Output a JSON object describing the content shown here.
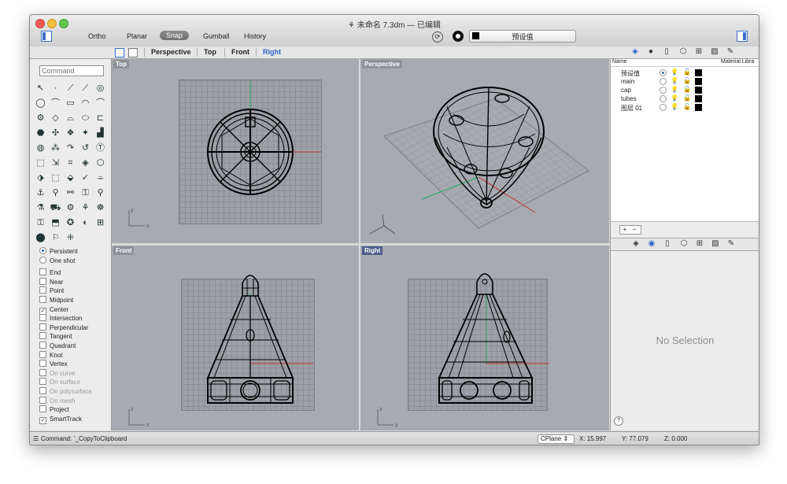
{
  "window": {
    "title": "未命名 7.3dm — 已编辑"
  },
  "toolbar": {
    "modes": [
      "Ortho",
      "Planar",
      "Snap",
      "Gumball",
      "History"
    ],
    "active_mode": "Snap",
    "current_layer": "预设值"
  },
  "viewbar": {
    "tabs": [
      "Perspective",
      "Top",
      "Front",
      "Right"
    ],
    "active_tab": "Right"
  },
  "left_panel": {
    "command_placeholder": "Command",
    "tools": [
      "↖",
      "·",
      "⟋",
      "⟋",
      "◎",
      "◯",
      "⌒",
      "▭",
      "◠",
      "⌒",
      "⚙",
      "◇",
      "⌓",
      "⬭",
      "⊏",
      "⬣",
      "✣",
      "❖",
      "✦",
      "▟",
      "◍",
      "⁂",
      "↷",
      "↺",
      "Ⓣ",
      "⬚",
      "⇲",
      "⌗",
      "◈",
      "⬡",
      "⬗",
      "⬚",
      "⬙",
      "✓",
      "⌯",
      "⚓",
      "⚲",
      "⚯",
      "⚿",
      "⚲",
      "⚗",
      "⛟",
      "⚙",
      "⚘",
      "☸",
      "⚿",
      "⬒",
      "✪",
      "◐",
      "⊞",
      "⬤",
      "⚐",
      "⁜"
    ],
    "snap_modes": [
      {
        "label": "Persistent",
        "type": "radio",
        "checked": true
      },
      {
        "label": "One shot",
        "type": "radio",
        "checked": false
      }
    ],
    "snaps": [
      {
        "label": "End",
        "checked": false,
        "disabled": false
      },
      {
        "label": "Near",
        "checked": false,
        "disabled": false
      },
      {
        "label": "Point",
        "checked": false,
        "disabled": false
      },
      {
        "label": "Midpoint",
        "checked": false,
        "disabled": false
      },
      {
        "label": "Center",
        "checked": true,
        "disabled": false
      },
      {
        "label": "Intersection",
        "checked": false,
        "disabled": false
      },
      {
        "label": "Perpendicular",
        "checked": false,
        "disabled": false
      },
      {
        "label": "Tangent",
        "checked": false,
        "disabled": false
      },
      {
        "label": "Quadrant",
        "checked": false,
        "disabled": false
      },
      {
        "label": "Knot",
        "checked": false,
        "disabled": false
      },
      {
        "label": "Vertex",
        "checked": false,
        "disabled": false
      },
      {
        "label": "On curve",
        "checked": false,
        "disabled": true
      },
      {
        "label": "On surface",
        "checked": false,
        "disabled": true
      },
      {
        "label": "On polysurface",
        "checked": false,
        "disabled": true
      },
      {
        "label": "On mesh",
        "checked": false,
        "disabled": true
      },
      {
        "label": "Project",
        "checked": false,
        "disabled": false
      },
      {
        "label": "SmartTrack",
        "checked": true,
        "disabled": false
      }
    ]
  },
  "viewports": {
    "top": {
      "label": "Top",
      "axis_a": "y",
      "axis_b": "x"
    },
    "perspective": {
      "label": "Perspective"
    },
    "front": {
      "label": "Front",
      "axis_a": "z",
      "axis_b": "x"
    },
    "right": {
      "label": "Right",
      "axis_a": "z",
      "axis_b": "y"
    }
  },
  "layers_panel": {
    "columns": [
      "Name",
      "Material Libra"
    ],
    "layers": [
      {
        "name": "预设值",
        "current": true
      },
      {
        "name": "main",
        "current": false
      },
      {
        "name": "cap",
        "current": false
      },
      {
        "name": "tubes",
        "current": false
      },
      {
        "name": "图层 01",
        "current": false
      }
    ],
    "plus": "+",
    "minus": "−"
  },
  "properties_panel": {
    "empty_text": "No Selection",
    "help": "?"
  },
  "statusbar": {
    "command_label": "Command:",
    "command_text": "'_CopyToClipboard",
    "cplane": "CPlane",
    "x": "X: 15.997",
    "y": "Y: 77.079",
    "z": "Z: 0.000"
  },
  "colors": {
    "viewport_bg": "#a7aab1",
    "accent": "#2a63c8",
    "x_axis": "#c0392b",
    "y_axis": "#27ae60"
  }
}
